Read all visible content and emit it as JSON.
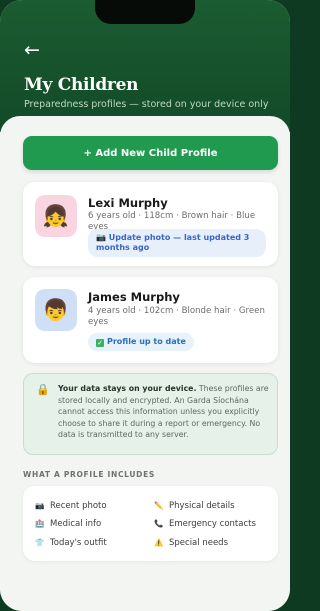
{
  "header": {
    "back_icon": "←",
    "title": "My Children",
    "subtitle": "Preparedness profiles — stored on your device only"
  },
  "actions": {
    "add_label": "+ Add New Child Profile"
  },
  "children": [
    {
      "name": "Lexi Murphy",
      "details": "6 years old · 118cm · Brown hair · Blue eyes",
      "status": "📷 Update photo — last updated 3 months ago",
      "avatar_icon": "👧",
      "status_color": "#3a66c4"
    },
    {
      "name": "James Murphy",
      "details": "4 years old · 102cm · Blonde hair · Green eyes",
      "status": "Profile up to date",
      "status_check": "✓",
      "avatar_icon": "👦",
      "status_color": "#2a6fb7"
    }
  ],
  "notice": {
    "icon": "🔒",
    "bold": "Your data stays on your device.",
    "text": " These profiles are stored locally and encrypted. An Garda Síochána cannot access this information unless you explicitly choose to share it during a report or emergency. No data is transmitted to any server."
  },
  "includes": {
    "heading": "WHAT A PROFILE INCLUDES",
    "items": [
      {
        "icon": "📷",
        "label": "Recent photo"
      },
      {
        "icon": "✏️",
        "label": "Physical details"
      },
      {
        "icon": "🏥",
        "label": "Medical info"
      },
      {
        "icon": "📞",
        "label": "Emergency contacts"
      },
      {
        "icon": "👕",
        "label": "Today's outfit"
      },
      {
        "icon": "⚠️",
        "label": "Special needs"
      }
    ]
  },
  "colors": {
    "brand_green": "#1f9a4e",
    "header_green": "#1b5c32",
    "notice_bg": "#e6f1ea"
  }
}
